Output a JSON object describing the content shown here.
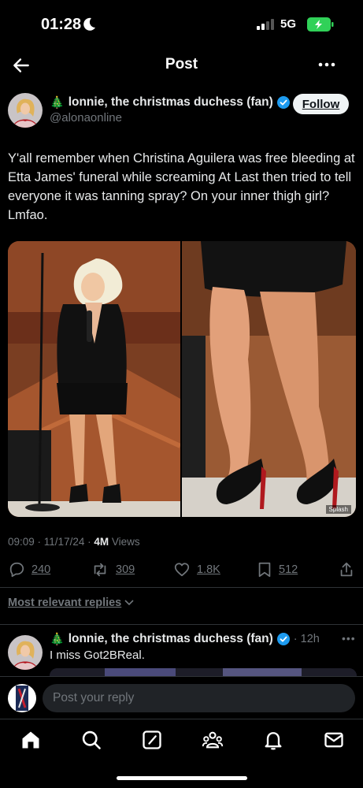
{
  "status_bar": {
    "time": "01:28",
    "network": "5G"
  },
  "nav": {
    "title": "Post"
  },
  "post": {
    "author_name": "lonnie, the christmas duchess (fan)",
    "handle": "@alonaonline",
    "follow_label": "Follow",
    "text": "Y'all remember when Christina Aguilera was free bleeding at Etta James' funeral while screaming At Last then tried to tell everyone it was tanning spray? On your inner thigh girl? Lmfao.",
    "media_credit": "Splash",
    "time": "09:09",
    "date": "11/17/24",
    "views_count": "4M",
    "views_label": "Views",
    "stats": {
      "replies": "240",
      "reposts": "309",
      "likes": "1.8K",
      "bookmarks": "512"
    }
  },
  "replies_sort": {
    "label": "Most relevant replies"
  },
  "reply": {
    "author_name": "lonnie, the christmas duchess (fan)",
    "time": "12h",
    "text": "I miss Got2BReal."
  },
  "compose": {
    "placeholder": "Post your reply"
  },
  "tabs": [
    "home-icon",
    "search-icon",
    "grok-icon",
    "communities-icon",
    "notifications-icon",
    "messages-icon"
  ],
  "colors": {
    "verified": "#1d9bf0",
    "battery": "#30d158",
    "follow_bg": "#eff3f4",
    "muted": "#71767b"
  }
}
